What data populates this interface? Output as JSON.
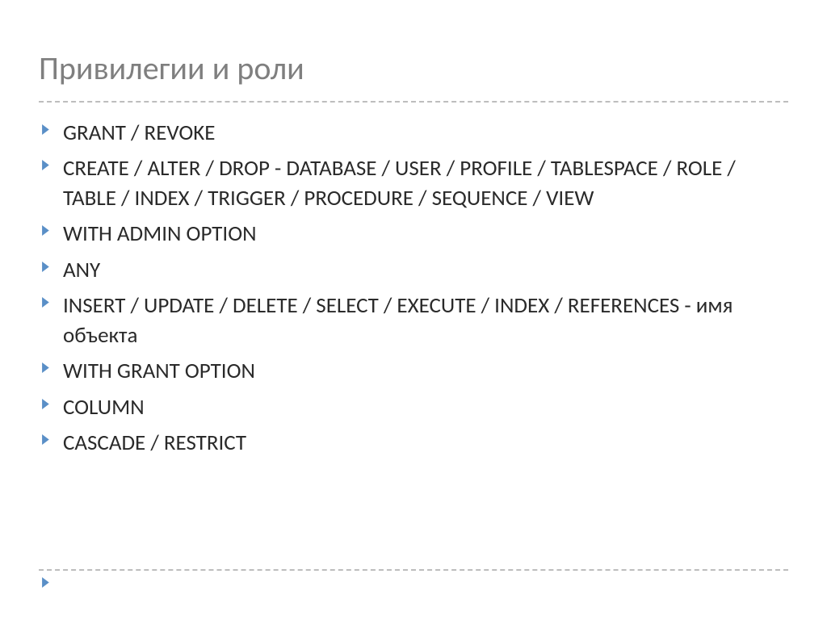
{
  "title": "Привилегии и роли",
  "bullets": [
    {
      "text": "GRANT / REVOKE"
    },
    {
      "text": "CREATE / ALTER / DROP - DATABASE / USER / PROFILE / TABLESPACE / ROLE / TABLE / INDEX / TRIGGER / PROCEDURE / SEQUENCE / VIEW"
    },
    {
      "text": "WITH ADMIN OPTION"
    },
    {
      "text": "ANY"
    },
    {
      "text": "INSERT / UPDATE / DELETE / SELECT / EXECUTE / INDEX / REFERENCES  - имя объекта"
    },
    {
      "text": "WITH GRANT OPTION"
    },
    {
      "text": "COLUMN"
    },
    {
      "text": "CASCADE / RESTRICT"
    }
  ]
}
